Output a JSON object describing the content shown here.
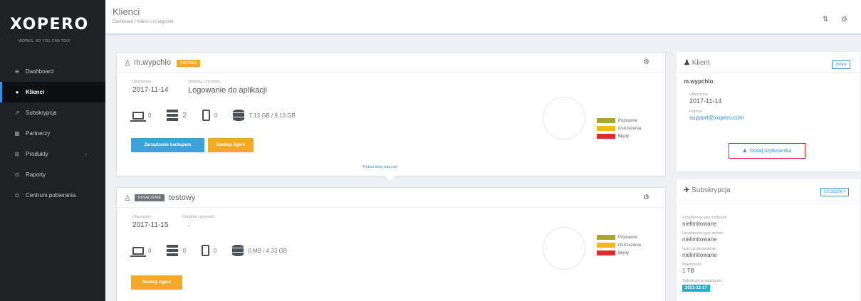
{
  "app": {
    "logo": "XOPERO",
    "tagline": "WORKS. SO YOU CAN TOO!"
  },
  "sidebar": {
    "items": [
      {
        "label": "Dashboard",
        "icon": "dashboard-icon",
        "glyph": "⊕",
        "active": false
      },
      {
        "label": "Klienci",
        "icon": "clients-icon",
        "glyph": "●",
        "active": true
      },
      {
        "label": "Subskrypcja",
        "icon": "chart-icon",
        "glyph": "↗",
        "active": false
      },
      {
        "label": "Partnerzy",
        "icon": "partners-icon",
        "glyph": "▦",
        "active": false
      },
      {
        "label": "Produkty",
        "icon": "cart-icon",
        "glyph": "⊞",
        "active": false
      },
      {
        "label": "Raporty",
        "icon": "report-icon",
        "glyph": "⊙",
        "active": false
      },
      {
        "label": "Centrum pobierania",
        "icon": "download-icon",
        "glyph": "◘",
        "active": false
      }
    ]
  },
  "header": {
    "title": "Klienci",
    "breadcrumb": "Dashboard  /  Klienci  /  m.wypchlo"
  },
  "clients": [
    {
      "username": "m.wypchlo",
      "badge": "PARTNER",
      "created_label": "Utworzony",
      "created": "2017-11-14",
      "last_activity_label": "Ostatnia czynność",
      "last_activity": "Logowanie do aplikacji",
      "laptops": "0",
      "servers": "2",
      "phones": "0",
      "storage": "7.13 GB / 9.13 GB",
      "buttons": {
        "manage": "Zarządzanie backupem",
        "agent": "Backup Agent"
      },
      "show_events": "Pokaż listę zdarzeń"
    },
    {
      "username": "testowy",
      "badge": "DOŁĄCZENIE",
      "created_label": "Utworzony",
      "created": "2017-11-15",
      "last_activity_label": "Ostatnia czynność",
      "last_activity": "-",
      "laptops": "0",
      "servers": "0",
      "phones": "0",
      "storage": "0 MB / 4.33 GB",
      "buttons": {
        "agent": "Backup Agent"
      }
    }
  ],
  "legend": [
    {
      "label": "Poprawne",
      "color": "#a7a82a"
    },
    {
      "label": "Ostrzeżenia",
      "color": "#f3b81f"
    },
    {
      "label": "Błędy",
      "color": "#d8302a"
    }
  ],
  "client_panel": {
    "title": "Klient",
    "action": "ZMIEŃ",
    "name": "m.wypchlo",
    "created_label": "Utworzony",
    "created": "2017-11-14",
    "partner_label": "Partner",
    "partner": "support@xopero.com",
    "add_user": "Dodaj użytkownika"
  },
  "subscription_panel": {
    "title": "Subskrypcja",
    "action": "SZCZEGÓŁY",
    "rows": [
      {
        "label": "Urządzenia typu endpoint",
        "value": "nielimitowane"
      },
      {
        "label": "Urządzenia typu serwer",
        "value": "nielimitowane"
      },
      {
        "label": "Ilość użytkowników",
        "value": "nielimitowane"
      },
      {
        "label": "Pojemność",
        "value": "1 TB"
      }
    ],
    "valid_label": "Subskrypcja ważna do",
    "valid_until": "2021-12-17"
  }
}
